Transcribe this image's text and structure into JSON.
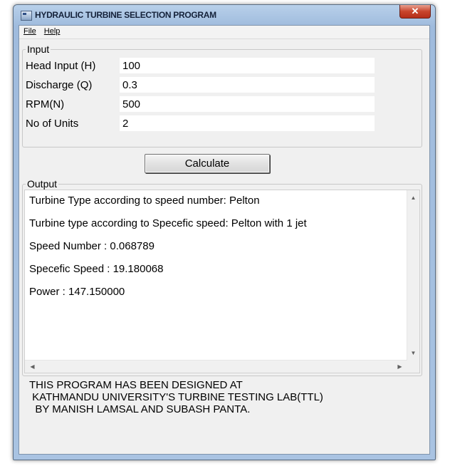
{
  "window": {
    "title": "HYDRAULIC TURBINE SELECTION PROGRAM",
    "close_glyph": "✕"
  },
  "menu": {
    "file": "File",
    "help": "Help"
  },
  "input": {
    "group_label": "Input",
    "fields": [
      {
        "label": "Head Input (H)",
        "value": "100"
      },
      {
        "label": "Discharge (Q)",
        "value": "0.3"
      },
      {
        "label": "RPM(N)",
        "value": "500"
      },
      {
        "label": "No of Units",
        "value": "2"
      }
    ]
  },
  "calculate_label": "Calculate",
  "output": {
    "group_label": "Output",
    "lines": [
      "Turbine Type according to speed number: Pelton",
      " Turbine type according to Specefic speed: Pelton with 1 jet",
      "Speed Number : 0.068789",
      " Specefic Speed : 19.180068",
      "Power : 147.150000"
    ]
  },
  "footer": {
    "lines": [
      "THIS PROGRAM HAS BEEN DESIGNED AT",
      " KATHMANDU UNIVERSITY'S TURBINE TESTING LAB(TTL)",
      "  BY MANISH LAMSAL AND SUBASH PANTA."
    ]
  },
  "icons": {
    "scroll_up": "▲",
    "scroll_down": "▼",
    "scroll_left": "◀",
    "scroll_right": "▶"
  }
}
